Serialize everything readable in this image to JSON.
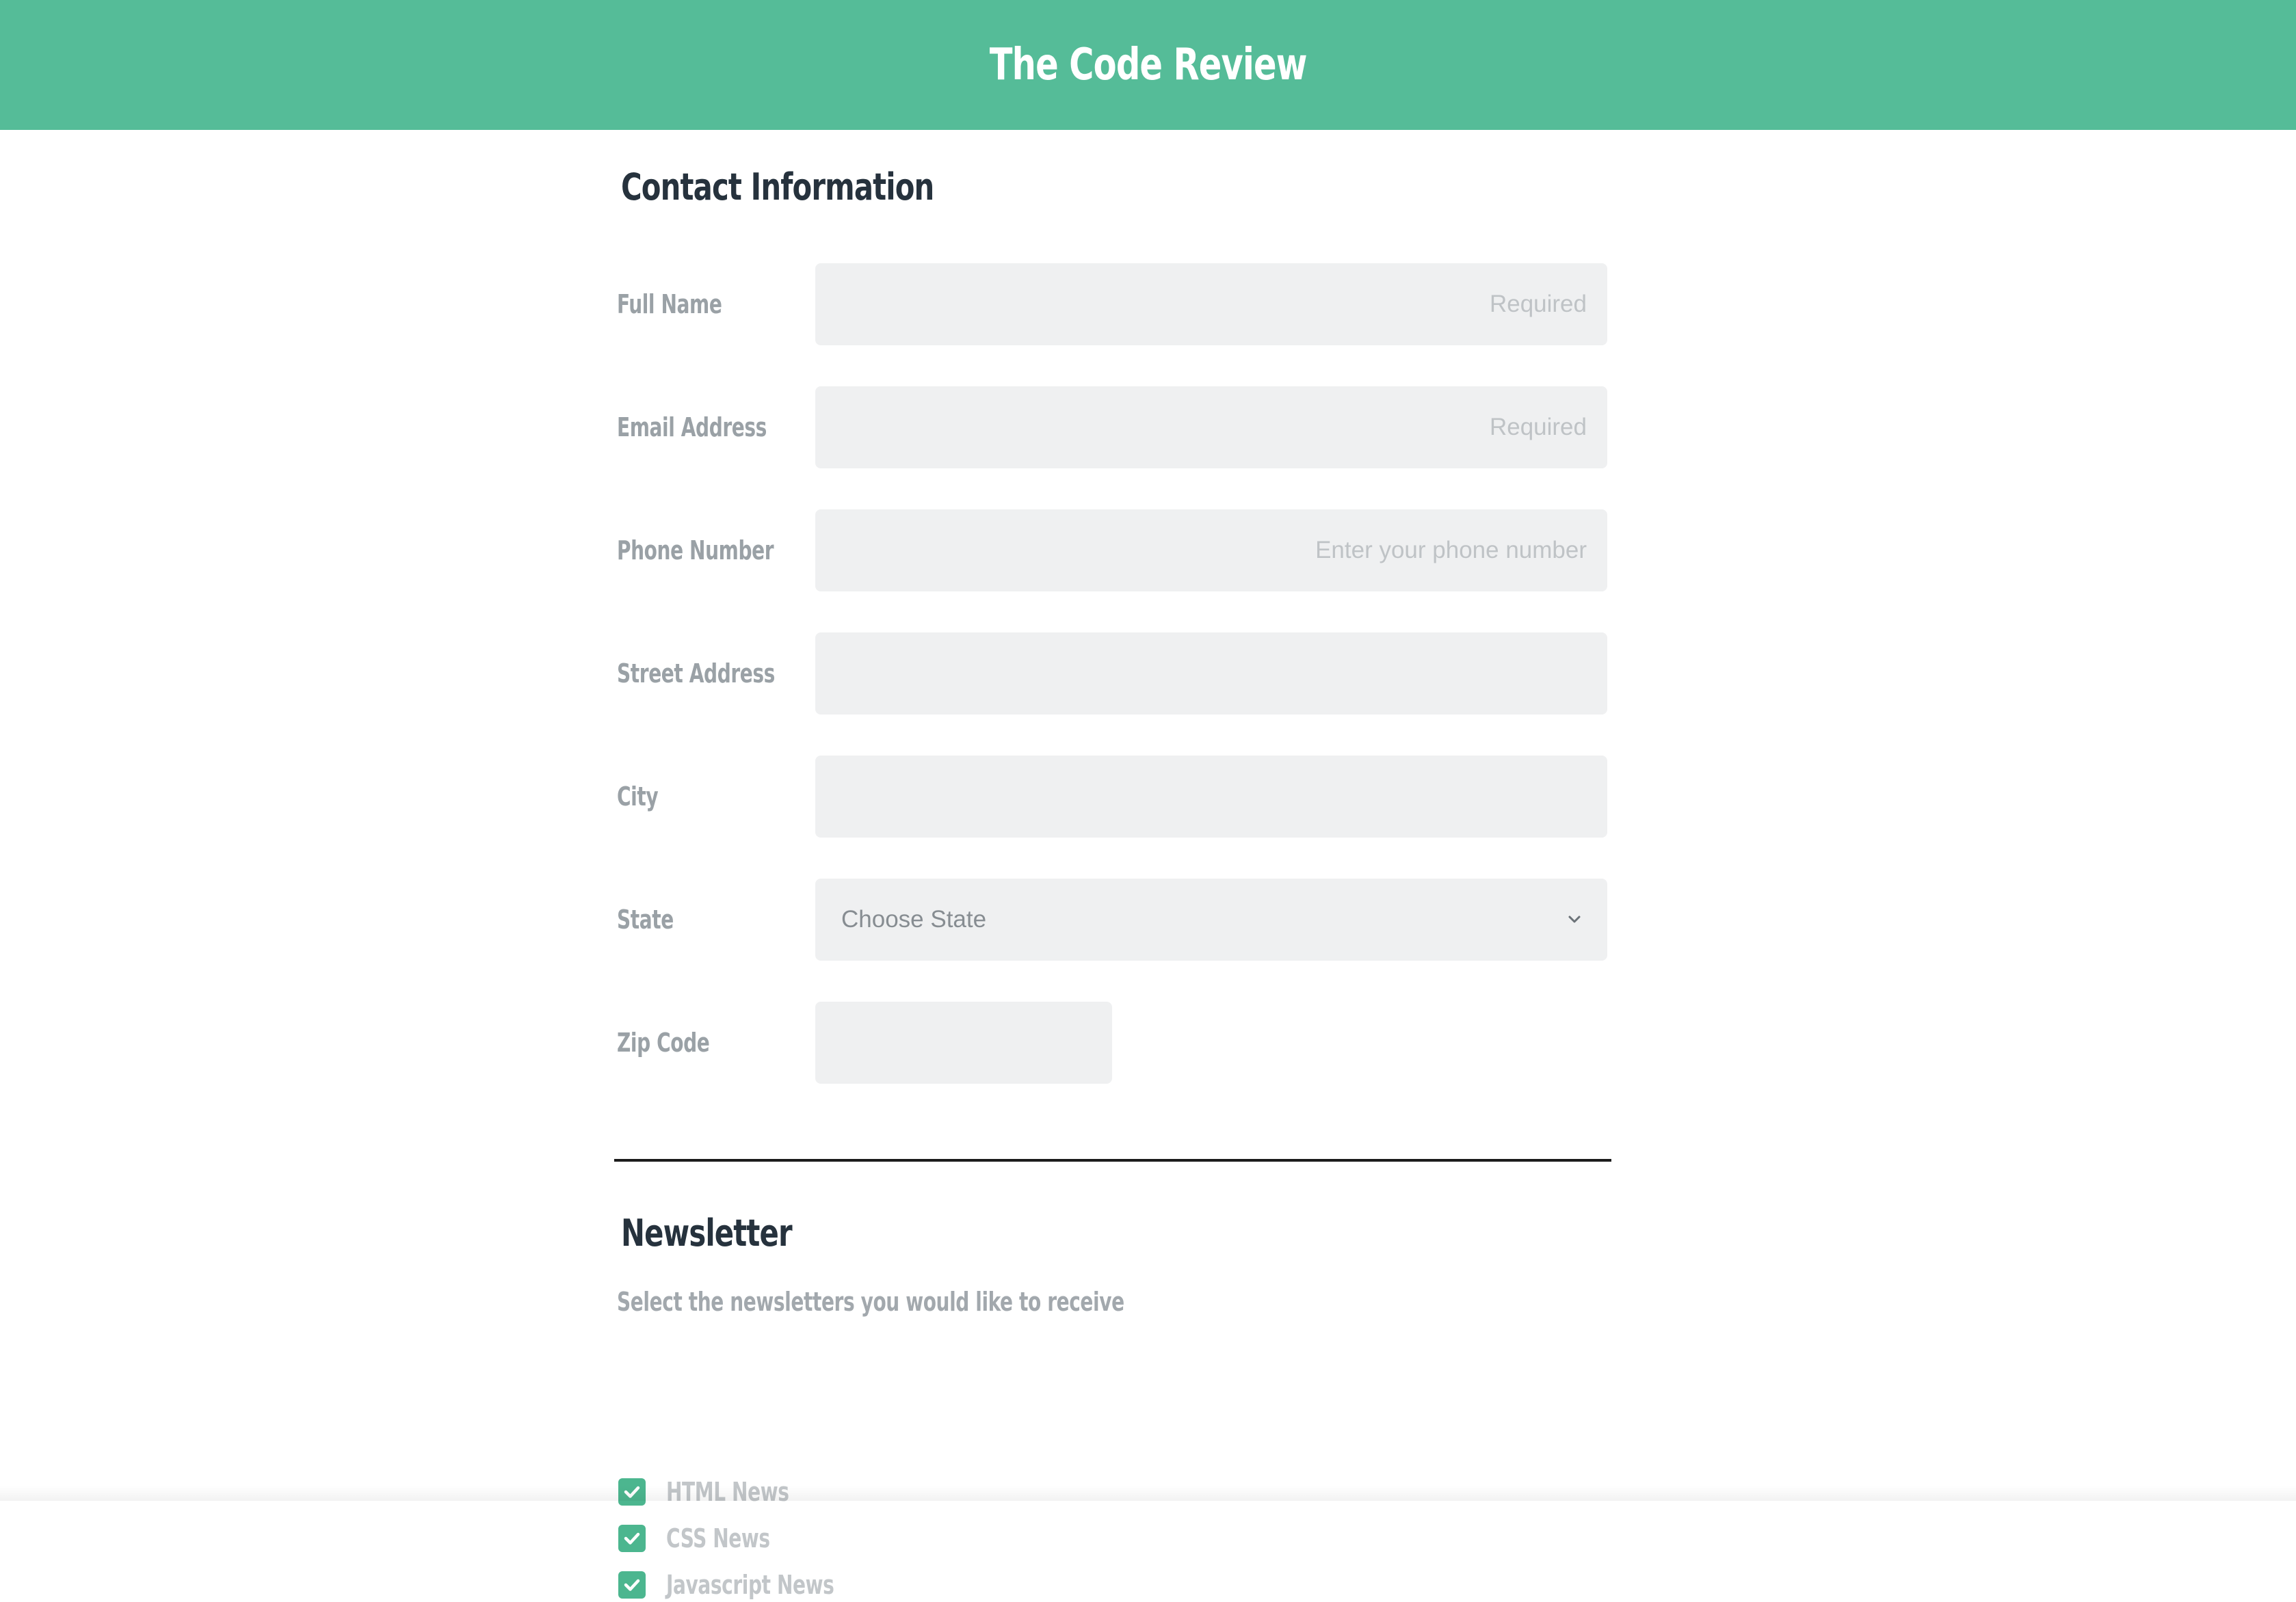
{
  "header": {
    "title": "The Code Review"
  },
  "contact": {
    "title": "Contact Information",
    "fields": [
      {
        "label": "Full Name",
        "placeholder": "Required",
        "value": ""
      },
      {
        "label": "Email Address",
        "placeholder": "Required",
        "value": ""
      },
      {
        "label": "Phone Number",
        "placeholder": "Enter your phone number",
        "value": ""
      },
      {
        "label": "Street Address",
        "placeholder": "",
        "value": ""
      },
      {
        "label": "City",
        "placeholder": "",
        "value": ""
      },
      {
        "label": "State",
        "selected": "Choose State"
      },
      {
        "label": "Zip Code",
        "placeholder": "",
        "value": ""
      }
    ]
  },
  "newsletter": {
    "title": "Newsletter",
    "description": "Select the newsletters you would like to receive",
    "options": [
      {
        "label": "HTML News",
        "checked": true
      },
      {
        "label": "CSS News",
        "checked": true
      },
      {
        "label": "Javascript News",
        "checked": true
      }
    ]
  },
  "colors": {
    "header_bg": "#55bc98",
    "checkbox": "#4cb68f",
    "input_bg": "#eff0f1",
    "heading": "#26323d"
  }
}
